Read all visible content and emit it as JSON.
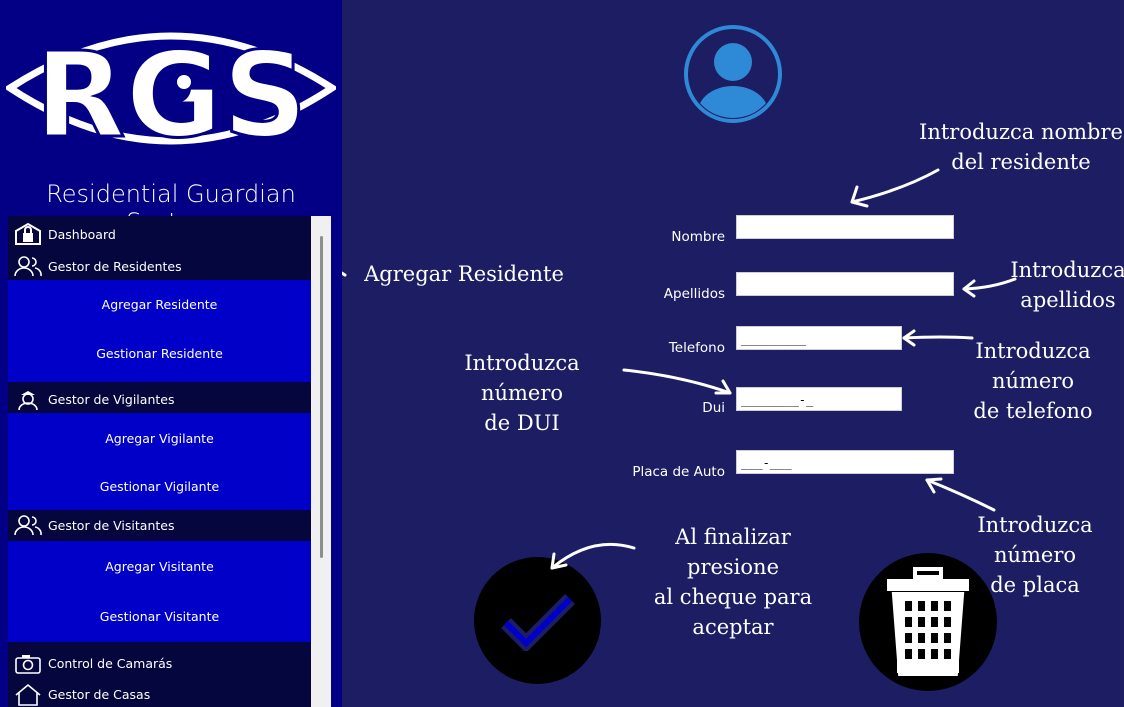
{
  "brand": {
    "logo_text": "RGS",
    "caption": "Residential Guardian System"
  },
  "menu": {
    "dashboard": "Dashboard",
    "residentes": {
      "label": "Gestor de Residentes",
      "items": [
        "Agregar Residente",
        "Gestionar Residente"
      ]
    },
    "vigilantes": {
      "label": "Gestor de Vigilantes",
      "items": [
        "Agregar Vigilante",
        "Gestionar Vigilante"
      ]
    },
    "visitantes": {
      "label": "Gestor de Visitantes",
      "items": [
        "Agregar Visitante",
        "Gestionar Visitante"
      ]
    },
    "camaras": "Control de Camarás",
    "casas": "Gestor de Casas"
  },
  "form": {
    "nombre": {
      "label": "Nombre",
      "value": ""
    },
    "apellidos": {
      "label": "Apellidos",
      "value": ""
    },
    "telefono": {
      "label": "Telefono",
      "value": "_________"
    },
    "dui": {
      "label": "Dui",
      "value": "________-_"
    },
    "placa": {
      "label": "Placa de Auto",
      "value": "___-___"
    }
  },
  "notes": {
    "agregar_residente": "Agregar Residente",
    "nombre": [
      "Introduzca nombre",
      "del residente"
    ],
    "apellidos": [
      "Introduzca",
      "apellidos"
    ],
    "telefono": [
      "Introduzca número",
      "de telefono"
    ],
    "dui": [
      "Introduzca número",
      "de DUI"
    ],
    "placa": [
      "Introduzca número",
      "de placa"
    ],
    "finalizar": [
      "Al finalizar presione",
      "al cheque para",
      "aceptar"
    ]
  },
  "colors": {
    "sidebar": "#030086",
    "menu_bg": "#06063f",
    "submenu_bg": "#0000c8",
    "content_bg": "#1d1d63",
    "avatar": "#2e8ad6"
  },
  "icons": {
    "avatar": "user-avatar-icon",
    "confirm": "check-icon",
    "delete": "trash-icon"
  }
}
